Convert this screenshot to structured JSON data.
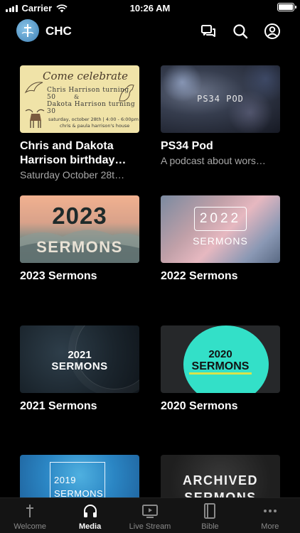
{
  "status_bar": {
    "carrier": "Carrier",
    "time": "10:26 AM",
    "battery_level": 1.0
  },
  "header": {
    "title": "CHC",
    "icons": [
      "chat-icon",
      "search-icon",
      "account-icon"
    ]
  },
  "media": {
    "items": [
      {
        "title": "Chris and Dakota Harrison birthday…",
        "subtitle": "Saturday October 28t…",
        "thumb": {
          "line1": "Come celebrate",
          "line2": "Chris Harrison turning 50",
          "line3": "&",
          "line4": "Dakota Harrison turning 30",
          "line5": "saturday, october 28th | 4:00 - 6:00pm",
          "line6": "chris & paula harrison's house"
        }
      },
      {
        "title": "PS34 Pod",
        "subtitle": "A podcast about wors…",
        "thumb": {
          "text": "PS34 POD"
        }
      },
      {
        "title": "2023 Sermons",
        "thumb": {
          "year": "2023",
          "label": "SERMONS"
        }
      },
      {
        "title": "2022 Sermons",
        "thumb": {
          "year": "2022",
          "label": "SERMONS"
        }
      },
      {
        "title": "2021 Sermons",
        "thumb": {
          "year": "2021",
          "label": "SERMONS"
        }
      },
      {
        "title": "2020 Sermons",
        "thumb": {
          "year": "2020",
          "label": "SERMONS"
        }
      },
      {
        "title": "",
        "thumb": {
          "year": "2019",
          "label": "SERMONS"
        }
      },
      {
        "title": "",
        "thumb": {
          "line1": "ARCHIVED",
          "line2": "SERMONS"
        }
      }
    ]
  },
  "tabbar": {
    "active": "Media",
    "tabs": [
      {
        "label": "Welcome",
        "icon": "cross-icon"
      },
      {
        "label": "Media",
        "icon": "headphones-icon"
      },
      {
        "label": "Live Stream",
        "icon": "play-screen-icon"
      },
      {
        "label": "Bible",
        "icon": "book-icon"
      },
      {
        "label": "More",
        "icon": "more-dots-icon"
      }
    ]
  }
}
